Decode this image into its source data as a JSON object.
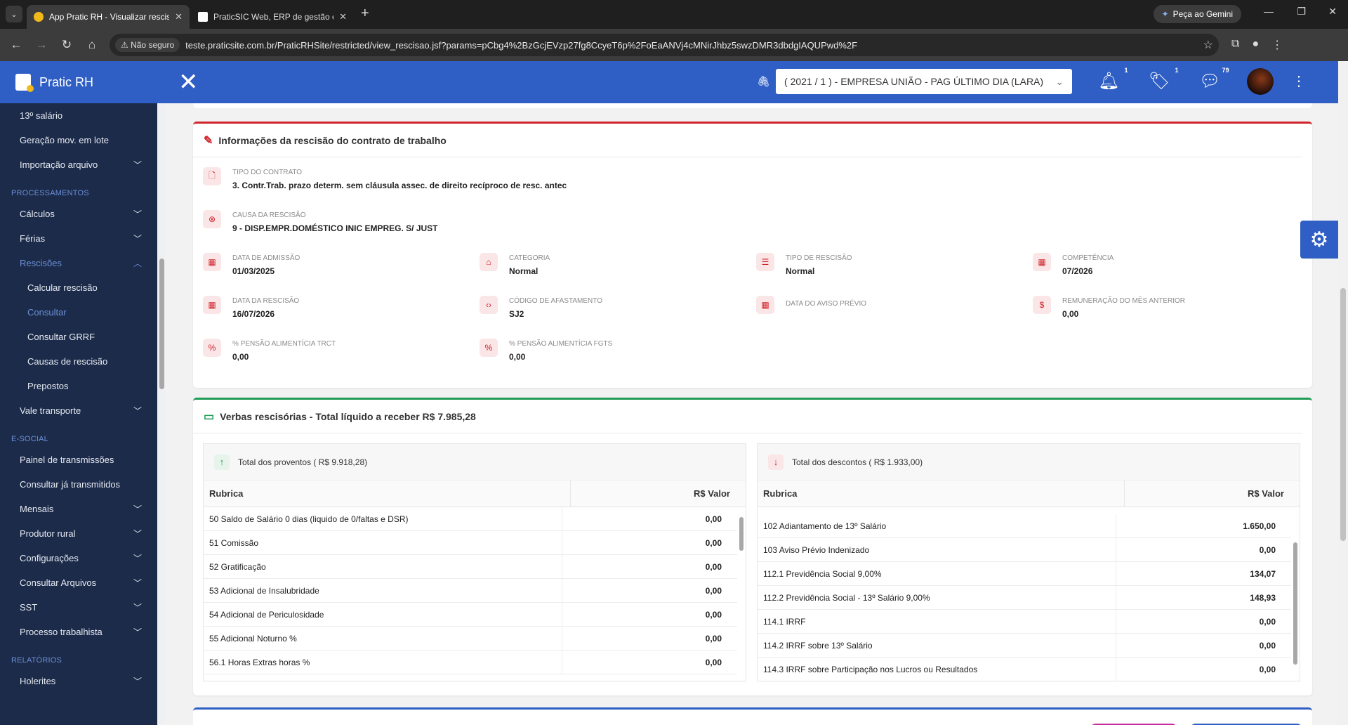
{
  "browser": {
    "tabs": [
      {
        "title": "App Pratic RH - Visualizar rescisão",
        "active": true
      },
      {
        "title": "PraticSIC Web, ERP de gestão em",
        "active": false
      }
    ],
    "gemini_label": "Peça ao Gemini",
    "security_label": "Não seguro",
    "url": "teste.praticsite.com.br/PraticRHSite/restricted/view_rescisao.jsf?params=pCbg4%2BzGcjEVzp27fg8CcyeT6p%2FoEaANVj4cMNirJhbz5swzDMR3dbdgIAQUPwd%2F"
  },
  "header": {
    "brand": "Pratic RH",
    "company_select": "( 2021 / 1 ) - EMPRESA UNIÃO - PAG ÚLTIMO DIA (LARA)",
    "notifications_count": "1",
    "tags_count": "1",
    "messages_count": "79"
  },
  "sidebar": {
    "items_top": [
      {
        "label": "13º salário",
        "chevron": false
      },
      {
        "label": "Geração mov. em lote",
        "chevron": false
      },
      {
        "label": "Importação arquivo",
        "chevron": true
      }
    ],
    "section_processamentos": "PROCESSAMENTOS",
    "items_proc": [
      {
        "label": "Cálculos",
        "chevron": true
      },
      {
        "label": "Férias",
        "chevron": true
      },
      {
        "label": "Rescisões",
        "chevron": true,
        "active": true
      }
    ],
    "items_rescisoes": [
      {
        "label": "Calcular rescisão",
        "active": false
      },
      {
        "label": "Consultar",
        "active": true
      },
      {
        "label": "Consultar GRRF",
        "active": false
      },
      {
        "label": "Causas de rescisão",
        "active": false
      },
      {
        "label": "Prepostos",
        "active": false
      }
    ],
    "item_vale": "Vale transporte",
    "section_esocial": "E-SOCIAL",
    "items_esocial": [
      {
        "label": "Painel de transmissões",
        "chevron": false
      },
      {
        "label": "Consultar já transmitidos",
        "chevron": false
      },
      {
        "label": "Mensais",
        "chevron": true
      },
      {
        "label": "Produtor rural",
        "chevron": true
      },
      {
        "label": "Configurações",
        "chevron": true
      },
      {
        "label": "Consultar Arquivos",
        "chevron": true
      },
      {
        "label": "SST",
        "chevron": true
      },
      {
        "label": "Processo trabalhista",
        "chevron": true
      }
    ],
    "section_relatorios": "RELATÓRIOS",
    "item_holerites": "Holerites"
  },
  "info_card": {
    "title": "Informações da rescisão do contrato de trabalho",
    "tipo_contrato": {
      "label": "TIPO DO CONTRATO",
      "value": "3. Contr.Trab. prazo determ. sem cláusula assec. de direito recíproco de resc. antec"
    },
    "causa_rescisao": {
      "label": "CAUSA DA RESCISÃO",
      "value": "9 - DISP.EMPR.DOMÉSTICO INIC EMPREG. S/ JUST"
    },
    "data_admissao": {
      "label": "DATA DE ADMISSÃO",
      "value": "01/03/2025"
    },
    "categoria": {
      "label": "CATEGORIA",
      "value": "Normal"
    },
    "tipo_rescisao": {
      "label": "TIPO DE RESCISÃO",
      "value": "Normal"
    },
    "competencia": {
      "label": "COMPETÊNCIA",
      "value": "07/2026"
    },
    "data_rescisao": {
      "label": "DATA DA RESCISÃO",
      "value": "16/07/2026"
    },
    "codigo_afastamento": {
      "label": "CÓDIGO DE AFASTAMENTO",
      "value": "SJ2"
    },
    "data_aviso": {
      "label": "DATA DO AVISO PRÉVIO",
      "value": ""
    },
    "remuneracao": {
      "label": "REMUNERAÇÃO DO MÊS ANTERIOR",
      "value": "0,00"
    },
    "pensao_trct": {
      "label": "% PENSÃO ALIMENTÍCIA TRCT",
      "value": "0,00"
    },
    "pensao_fgts": {
      "label": "% PENSÃO ALIMENTÍCIA FGTS",
      "value": "0,00"
    }
  },
  "verbas_card": {
    "title": "Verbas rescisórias - Total líquido a receber R$ 7.985,28",
    "proventos": {
      "header": "Total dos proventos ( R$ 9.918,28)",
      "col_rubrica": "Rubrica",
      "col_valor": "R$ Valor",
      "rows": [
        {
          "rubrica": "50 Saldo de Salário 0 dias (liquido de 0/faltas e DSR)",
          "valor": "0,00"
        },
        {
          "rubrica": "51 Comissão",
          "valor": "0,00"
        },
        {
          "rubrica": "52 Gratificação",
          "valor": "0,00"
        },
        {
          "rubrica": "53 Adicional de Insalubridade",
          "valor": "0,00"
        },
        {
          "rubrica": "54 Adicional de Periculosidade",
          "valor": "0,00"
        },
        {
          "rubrica": "55 Adicional Noturno %",
          "valor": "0,00"
        },
        {
          "rubrica": "56.1 Horas Extras horas %",
          "valor": "0,00"
        }
      ]
    },
    "descontos": {
      "header": "Total dos descontos ( R$ 1.933,00)",
      "col_rubrica": "Rubrica",
      "col_valor": "R$ Valor",
      "rows": [
        {
          "rubrica": "102 Adiantamento de 13º Salário",
          "valor": "1.650,00"
        },
        {
          "rubrica": "103 Aviso Prévio Indenizado",
          "valor": "0,00"
        },
        {
          "rubrica": "112.1 Previdência Social 9,00%",
          "valor": "134,07"
        },
        {
          "rubrica": "112.2 Previdência Social - 13º Salário 9,00%",
          "valor": "148,93"
        },
        {
          "rubrica": "114.1 IRRF",
          "valor": "0,00"
        },
        {
          "rubrica": "114.2 IRRF sobre 13º Salário",
          "valor": "0,00"
        },
        {
          "rubrica": "114.3 IRRF sobre Participação nos Lucros ou Resultados",
          "valor": "0,00"
        }
      ]
    }
  },
  "colors": {
    "header_blue": "#2f5fc4",
    "sidebar_bg": "#1c2b4a",
    "info_accent": "#d0242c",
    "verbas_accent": "#1f9d55"
  }
}
